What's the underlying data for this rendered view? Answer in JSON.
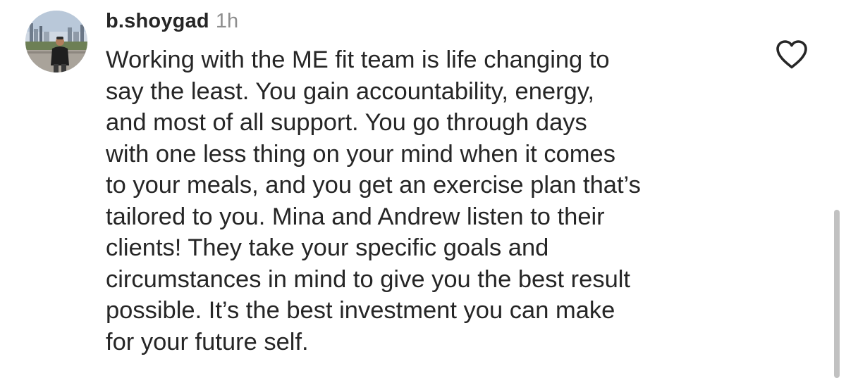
{
  "comment": {
    "username": "b.shoygad",
    "timestamp": "1h",
    "lines": [
      "Working with the ME fit team is life changing to",
      "say the least. You gain accountability, energy,",
      "and most of all support. You go through days",
      "with one less thing on your mind when it comes",
      "to your meals, and you get an exercise plan that’s",
      "tailored to you. Mina and Andrew listen to their",
      "clients! They take your specific goals and",
      "circumstances in mind to give you the best result",
      "possible. It’s the best investment you can make",
      "for your future self."
    ],
    "like_icon": "heart-outline-icon"
  },
  "colors": {
    "text": "#262626",
    "muted": "#8e8e8e",
    "icon": "#262626",
    "background": "#ffffff",
    "scrollbar": "#c1c1c1"
  }
}
